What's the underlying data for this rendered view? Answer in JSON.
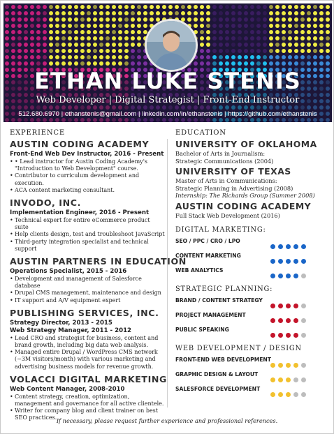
{
  "header": {
    "name": "ETHAN LUKE STENIS",
    "subtitle": "Web Developer | Digital Strategist | Front-End Instructor",
    "contact": "512.680.6970 | ethanstenis@gmail.com | linkedin.com/in/ethanstenis | https://github.com/ethanstenis"
  },
  "experience": {
    "label": "EXPERIENCE",
    "jobs": [
      {
        "org": "AUSTIN CODING ACADEMY",
        "roles": [
          {
            "title": "Front-End Web Dev Instructor, 2016 - Present",
            "bullets": [
              "• Lead instructor for Austin Coding Academy's \"Introduction to Web Development\" course.",
              "Contributor to curriculum development and execution.",
              "ACA content marketing consultant."
            ]
          }
        ]
      },
      {
        "org": "INVODO, INC.",
        "roles": [
          {
            "title": "Implementation Engineer, 2016 - Present",
            "bullets": [
              "Technical expert for entire eCommerce product suite",
              "Help clients design, test and troubleshoot JavaScript",
              "Third-party integration specialist and technical support"
            ]
          }
        ]
      },
      {
        "org": "AUSTIN PARTNERS IN EDUCATION",
        "roles": [
          {
            "title": "Operations Specialist, 2015 - 2016",
            "bullets": [
              "Development and management of Salesforce database",
              "Drupal CMS management, maintenance and design",
              "IT support and A/V equipment expert"
            ]
          }
        ]
      },
      {
        "org": "PUBLISHING SERVICES, INC.",
        "roles": [
          {
            "title": "Strategy Director, 2013 - 2015",
            "bullets": []
          },
          {
            "title": "Web Strategy Manager, 2011 - 2012",
            "bullets": [
              "Lead CRO and strategist for business, content and brand growth, including big data web analysis.",
              "Managed entire Drupal / WordPress CMS network (~3M visitors/month) with various marketing and advertising business models for revenue growth."
            ]
          }
        ]
      },
      {
        "org": "VOLACCI DIGITAL MARKETING",
        "roles": [
          {
            "title": "Web Content Manager, 2008-2010",
            "bullets": [
              "Content strategy, creation, optimization, management and governance for all active clientele.",
              "Writer for company blog and client trainer on best SEO practices."
            ]
          }
        ]
      }
    ]
  },
  "education": {
    "label": "EDUCATION",
    "schools": [
      {
        "name": "UNIVERSITY OF OKLAHOMA",
        "lines": [
          "Bachelor of Arts in Journalism:",
          "Strategic Communications (2004)"
        ],
        "italic": ""
      },
      {
        "name": "UNIVERSITY OF TEXAS",
        "lines": [
          "Master of Arts in Communications:",
          "Strategic Planning in Advertising (2008)"
        ],
        "italic": "Internship: The Richards Group (Summer 2008)"
      },
      {
        "name": "AUSTIN CODING ACADEMY",
        "lines": [
          "Full Stack Web Development (2016)"
        ],
        "italic": ""
      }
    ]
  },
  "skills": [
    {
      "heading": "DIGITAL MARKETING:",
      "color": "#1a66c8",
      "items": [
        {
          "name": "SEO / PPC / CRO / LPO",
          "level": 5
        },
        {
          "name": "CONTENT MARKETING",
          "level": 5
        },
        {
          "name": "WEB ANALYTICS",
          "level": 4
        }
      ]
    },
    {
      "heading": "STRATEGIC PLANNING:",
      "color": "#c4142a",
      "items": [
        {
          "name": "BRAND / CONTENT STRATEGY",
          "level": 4
        },
        {
          "name": "PROJECT MANAGEMENT",
          "level": 4
        },
        {
          "name": "PUBLIC SPEAKING",
          "level": 4
        }
      ]
    },
    {
      "heading": "WEB DEVELOPMENT / DESIGN",
      "color": "#f2c12e",
      "items": [
        {
          "name": "FRONT-END WEB DEVELOPMENT",
          "level": 4
        },
        {
          "name": "GRAPHIC DESIGN & LAYOUT",
          "level": 3
        },
        {
          "name": "SALESFORCE DEVELOPMENT",
          "level": 3
        }
      ]
    }
  ],
  "skill_max": 5,
  "footer": "If necessary, please request further experience and professional references.",
  "colors": {
    "dot_empty": "#bdbdbd",
    "header_bg": "#1d1638"
  }
}
